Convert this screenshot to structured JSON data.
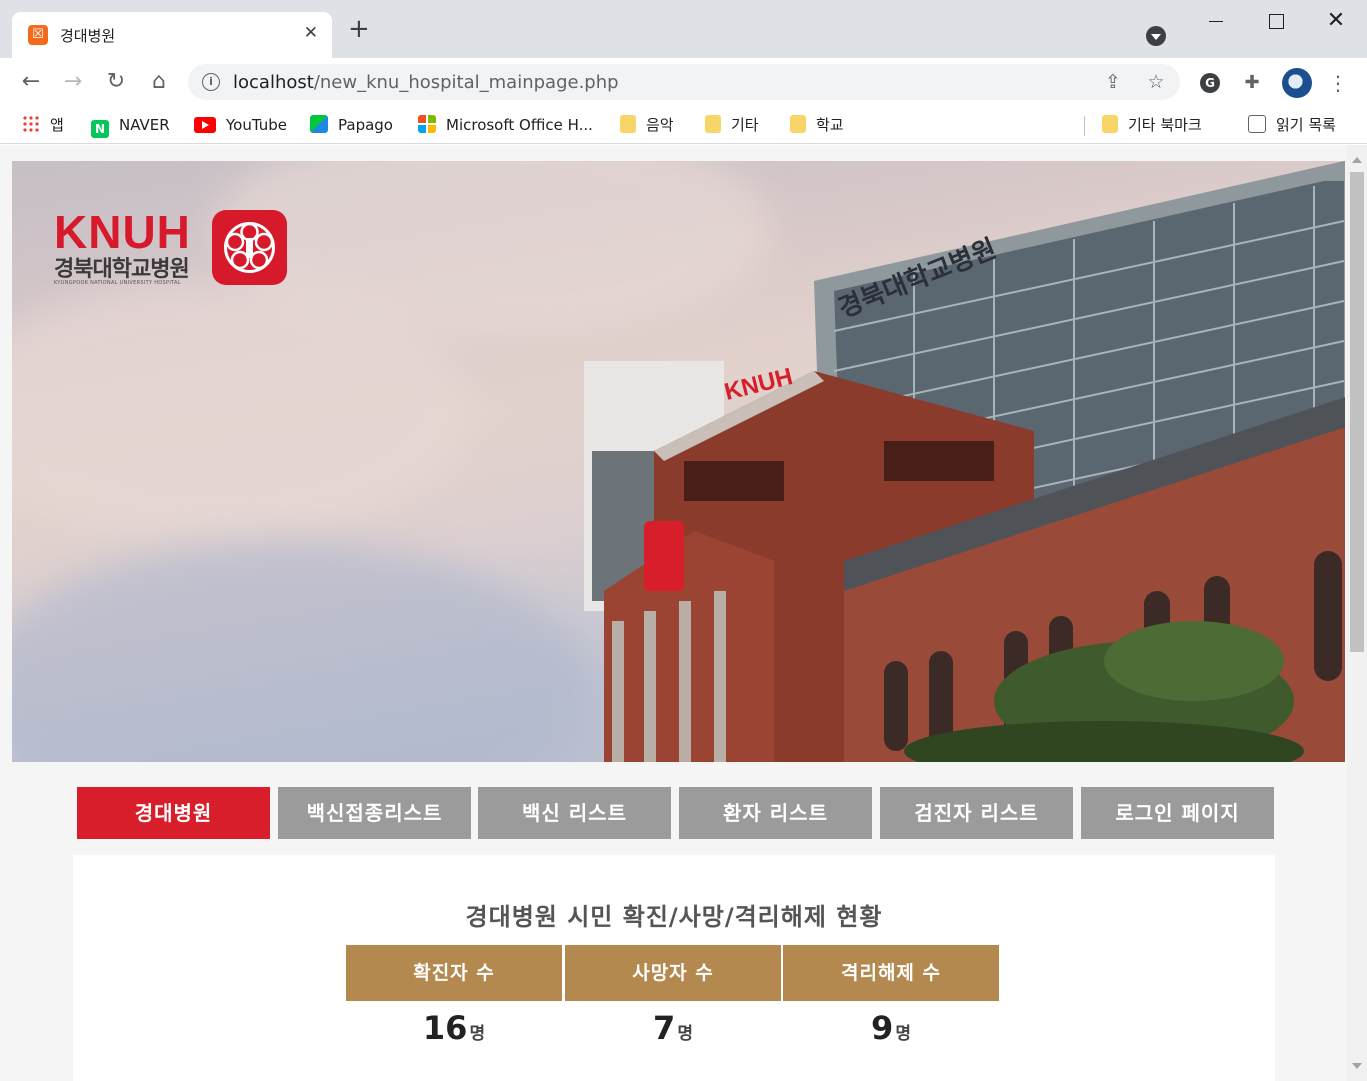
{
  "browser": {
    "tab_title": "경대병원",
    "tab_favicon_glyph": "☒",
    "url_host": "localhost",
    "url_path": "/new_knu_hospital_mainpage.php",
    "bookmarks": [
      {
        "label": "앱",
        "icon": "apps-icon"
      },
      {
        "label": "NAVER",
        "icon": "naver-icon"
      },
      {
        "label": "YouTube",
        "icon": "youtube-icon"
      },
      {
        "label": "Papago",
        "icon": "papago-icon"
      },
      {
        "label": "Microsoft Office H...",
        "icon": "microsoft-icon"
      },
      {
        "label": "음악",
        "icon": "folder-icon"
      },
      {
        "label": "기타",
        "icon": "folder-icon"
      },
      {
        "label": "학교",
        "icon": "folder-icon"
      }
    ],
    "other_bookmarks": "기타 북마크",
    "reading_list": "읽기 목록"
  },
  "hero": {
    "logo_text": "KNUH",
    "logo_korean": "경북대학교병원",
    "logo_english": "KYUNGPOOK NATIONAL UNIVERSITY HOSPITAL",
    "sign_text": "경북대학교병원",
    "sign_logo": "KNUH"
  },
  "menu": [
    {
      "label": "경대병원",
      "active": true
    },
    {
      "label": "백신접종리스트",
      "active": false
    },
    {
      "label": "백신 리스트",
      "active": false
    },
    {
      "label": "환자 리스트",
      "active": false
    },
    {
      "label": "검진자 리스트",
      "active": false
    },
    {
      "label": "로그인 페이지",
      "active": false
    }
  ],
  "stats": {
    "title": "경대병원 시민 확진/사망/격리해제 현황",
    "headers": [
      "확진자 수",
      "사망자 수",
      "격리해제 수"
    ],
    "values": [
      "16",
      "7",
      "9"
    ],
    "unit": "명"
  },
  "colors": {
    "active_menu": "#d71e2a",
    "inactive_menu": "#9b9b9b",
    "stat_header": "#b3894f",
    "brand_red": "#d7192c"
  }
}
